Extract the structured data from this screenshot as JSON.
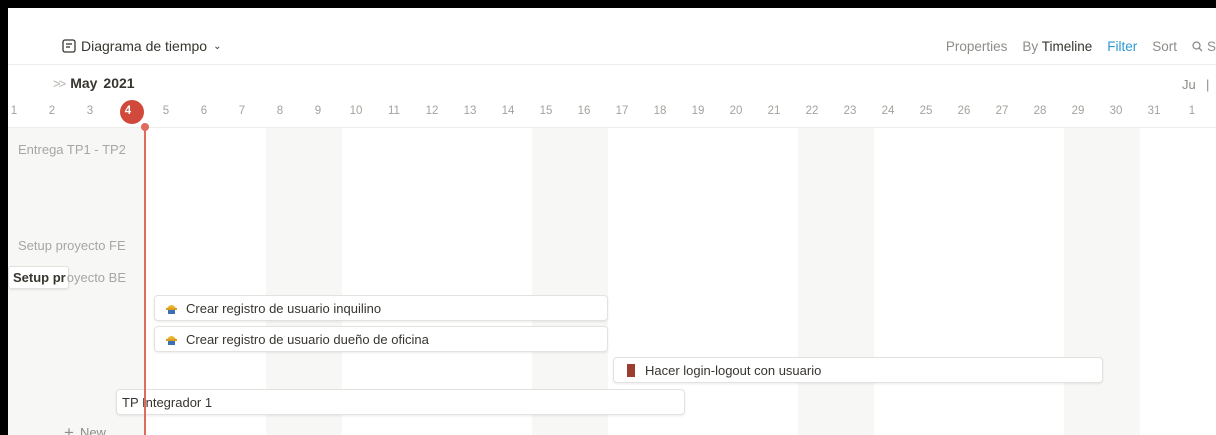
{
  "toolbar": {
    "view_title": "Diagrama de tiempo",
    "properties": "Properties",
    "by_label": "By",
    "timeline_label": "Timeline",
    "filter": "Filter",
    "sort": "Sort",
    "search_fragment": "S"
  },
  "timeline": {
    "month_prefix": "May",
    "month_year": "2021",
    "next_month_fragment": "Ju",
    "days": [
      "1",
      "2",
      "3",
      "4",
      "5",
      "6",
      "7",
      "8",
      "9",
      "10",
      "11",
      "12",
      "13",
      "14",
      "15",
      "16",
      "17",
      "18",
      "19",
      "20",
      "21",
      "22",
      "23",
      "24",
      "25",
      "26",
      "27",
      "28",
      "29",
      "30",
      "31",
      "1"
    ],
    "today": "4"
  },
  "rows": {
    "entrega": "Entrega TP1 - TP2",
    "setup_fe": "Setup proyecto FE",
    "setup_be_visible": "Setup pr",
    "setup_be_rest": "oyecto BE",
    "task1": "Crear registro de usuario inquilino",
    "task2": "Crear registro de usuario dueño de oficina",
    "task3": "Hacer login-logout con usuario",
    "task4": "TP Integrador 1",
    "new_label": "New"
  },
  "colors": {
    "accent_blue": "#2e9ad1",
    "today_red": "#d0493b",
    "task3_icon": "#9b3e2f",
    "task_icon_yellow": "#e7b431"
  }
}
